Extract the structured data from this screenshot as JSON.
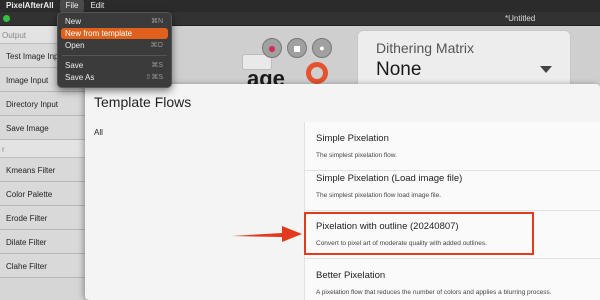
{
  "menubar": {
    "app_name": "PixelAfterAll",
    "items": [
      {
        "label": "File"
      },
      {
        "label": "Edit"
      }
    ]
  },
  "window": {
    "title": "*Untitled"
  },
  "left_panel": {
    "section_output": "Output",
    "nodes_top": [
      "Test Image Input",
      "Image Input",
      "Directory Input",
      "Save Image"
    ],
    "section_filter": "r",
    "nodes_bottom": [
      "Kmeans Filter",
      "Color Palette",
      "Erode Filter",
      "Dilate Filter",
      "Clahe Filter"
    ]
  },
  "canvas": {
    "logo_text": "age",
    "dithering": {
      "label": "Dithering Matrix",
      "value": "None"
    }
  },
  "file_menu": {
    "items": [
      {
        "label": "New",
        "shortcut": "⌘N"
      },
      {
        "label": "New from template",
        "shortcut": ""
      },
      {
        "label": "Open",
        "shortcut": "⌘O"
      },
      {
        "label": "Save",
        "shortcut": "⌘S"
      },
      {
        "label": "Save As",
        "shortcut": "⇧⌘S"
      }
    ]
  },
  "dialog": {
    "title": "Template Flows",
    "categories": [
      "All"
    ],
    "flows": [
      {
        "name": "Simple Pixelation",
        "desc": "The simplest pixelation flow."
      },
      {
        "name": "Simple Pixelation (Load image file)",
        "desc": "The simplest pixelation flow load image file."
      },
      {
        "name": "Pixelation with outline (20240807)",
        "desc": "Convert to pixel art of moderate quality with added outlines."
      },
      {
        "name": "Better Pixelation",
        "desc": "A pixelation flow that reduces the number of colors and applies a blurring process."
      }
    ]
  },
  "colors": {
    "accent_menu_highlight": "#e0611e",
    "annotation_red": "#e23a1c",
    "record_button": "#d6285a"
  },
  "icons": [
    "record-icon",
    "stop-icon",
    "eye-icon",
    "chevron-down-icon",
    "arrow-annotation-icon"
  ]
}
